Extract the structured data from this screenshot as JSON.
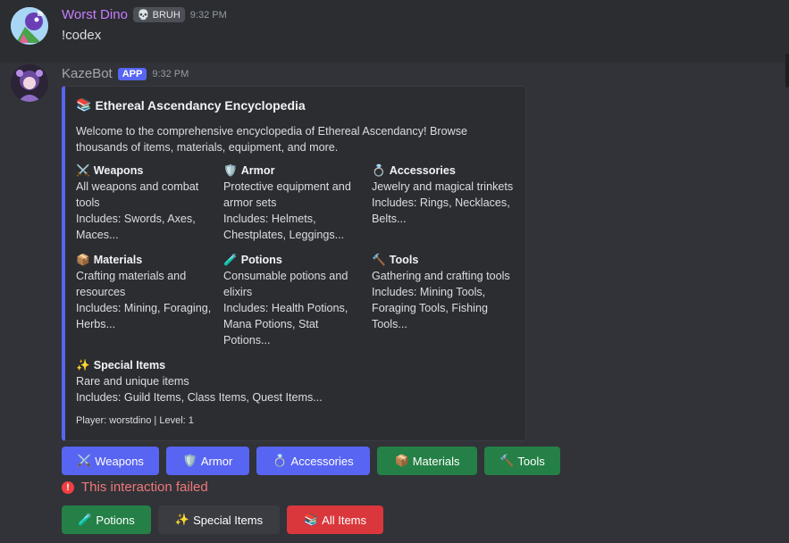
{
  "messages": [
    {
      "username": "Worst Dino",
      "tag": "BRUH",
      "timestamp": "9:32 PM",
      "content": "!codex",
      "avatar": "dino-avatar"
    },
    {
      "username": "KazeBot",
      "badge": "APP",
      "timestamp": "9:32 PM",
      "avatar": "anime-avatar"
    }
  ],
  "embed": {
    "title": "Ethereal Ascendancy Encyclopedia",
    "title_icon": "books-icon",
    "description": "Welcome to the comprehensive encyclopedia of Ethereal Ascendancy! Browse thousands of items, materials, equipment, and more.",
    "fields": [
      {
        "icon": "⚔️",
        "name": "Weapons",
        "line1": "All weapons and combat tools",
        "line2": "Includes: Swords, Axes, Maces..."
      },
      {
        "icon": "🛡️",
        "name": "Armor",
        "line1": "Protective equipment and armor sets",
        "line2": "Includes: Helmets, Chestplates, Leggings..."
      },
      {
        "icon": "💍",
        "name": "Accessories",
        "line1": "Jewelry and magical trinkets",
        "line2": "Includes: Rings, Necklaces, Belts..."
      },
      {
        "icon": "📦",
        "name": "Materials",
        "line1": "Crafting materials and resources",
        "line2": "Includes: Mining, Foraging, Herbs..."
      },
      {
        "icon": "🧪",
        "name": "Potions",
        "line1": "Consumable potions and elixirs",
        "line2": "Includes: Health Potions, Mana Potions, Stat Potions..."
      },
      {
        "icon": "🔨",
        "name": "Tools",
        "line1": "Gathering and crafting tools",
        "line2": "Includes: Mining Tools, Foraging Tools, Fishing Tools..."
      },
      {
        "icon": "✨",
        "name": "Special Items",
        "line1": "Rare and unique items",
        "line2": "Includes: Guild Items, Class Items, Quest Items..."
      }
    ],
    "footer": "Player: worstdino | Level: 1",
    "accent_color": "#5865f2"
  },
  "buttons_row1": [
    {
      "icon": "⚔️",
      "label": "Weapons",
      "style": "blurple"
    },
    {
      "icon": "🛡️",
      "label": "Armor",
      "style": "blurple"
    },
    {
      "icon": "💍",
      "label": "Accessories",
      "style": "blurple"
    },
    {
      "icon": "📦",
      "label": "Materials",
      "style": "green"
    },
    {
      "icon": "🔨",
      "label": "Tools",
      "style": "green"
    }
  ],
  "error_text": "This interaction failed",
  "buttons_row2": [
    {
      "icon": "🧪",
      "label": "Potions",
      "style": "green"
    },
    {
      "icon": "✨",
      "label": "Special Items",
      "style": "grey"
    },
    {
      "icon": "📚",
      "label": "All Items",
      "style": "red"
    }
  ],
  "colors": {
    "background": "#313338",
    "blurple": "#5865f2",
    "green": "#248046",
    "red": "#da373c",
    "error": "#f23f43"
  }
}
